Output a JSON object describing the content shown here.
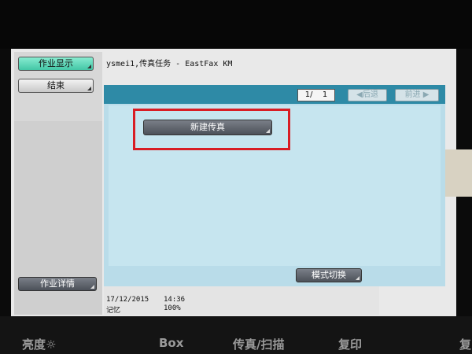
{
  "window": {
    "title": "ysmei1,传真任务 - EastFax KM"
  },
  "sidebar": {
    "job_display_label": "作业显示",
    "end_label": "结束",
    "job_details_label": "作业详情"
  },
  "main": {
    "page_indicator": {
      "current": "1/",
      "total": "1"
    },
    "prev_label": "◀后退",
    "next_label": "前进 ▶",
    "new_fax_label": "新建传真",
    "mode_switch_label": "模式切换"
  },
  "status": {
    "date": "17/12/2015",
    "time": "14:36",
    "memory_label": "记忆",
    "memory_value": "100%"
  },
  "hardware": {
    "brightness_label": "亮度☼",
    "box_label": "Box",
    "fax_scan_label": "传真/扫描",
    "copy_label": "复印",
    "edge_label": "复"
  },
  "colors": {
    "accent_active": "#43c7a6",
    "content_bar": "#2e8aa6",
    "highlight_box": "#d81d24"
  }
}
